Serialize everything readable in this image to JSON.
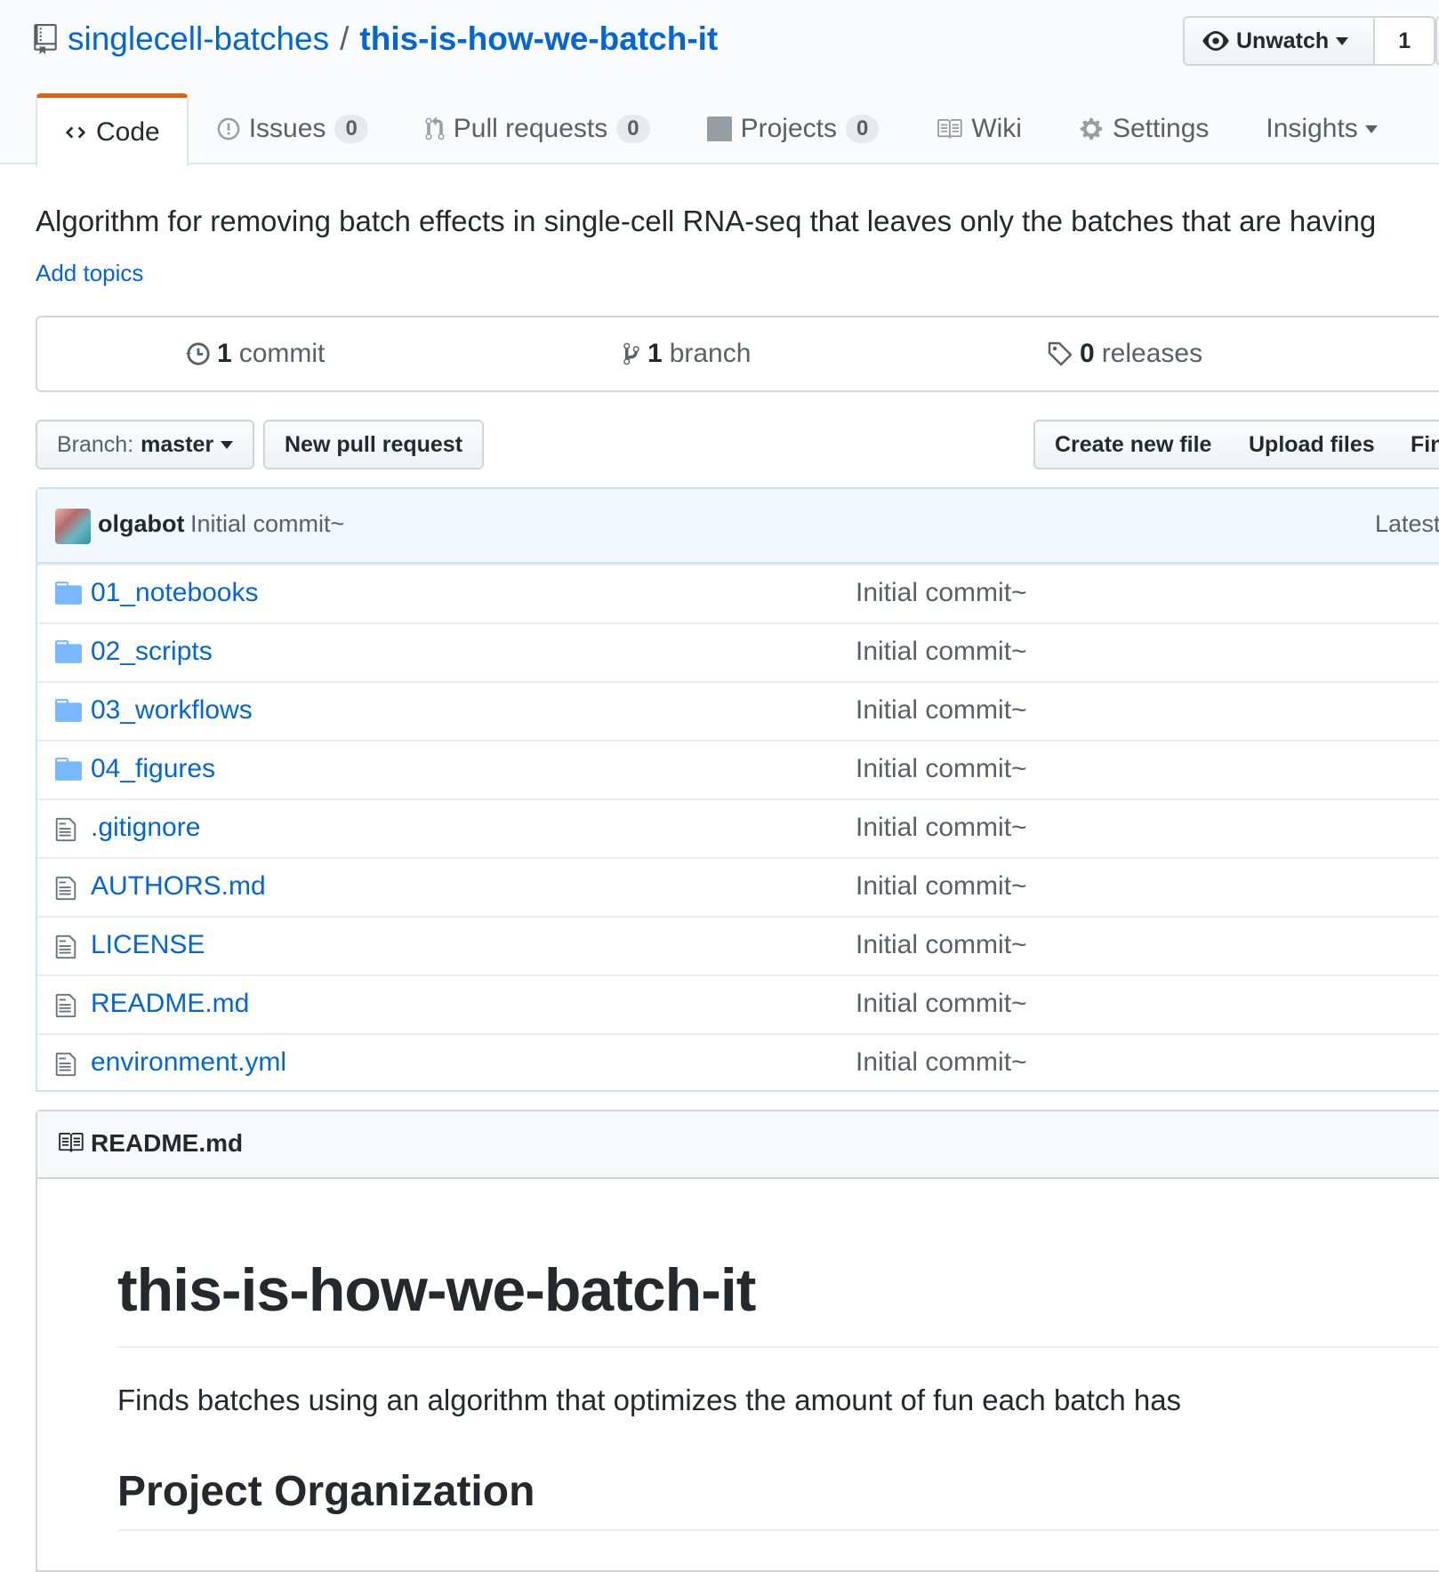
{
  "repo": {
    "owner": "singlecell-batches",
    "separator": "/",
    "name": "this-is-how-we-batch-it"
  },
  "watch": {
    "label": "Unwatch",
    "count": "1"
  },
  "nav": {
    "code": "Code",
    "issues": "Issues",
    "issues_count": "0",
    "pulls": "Pull requests",
    "pulls_count": "0",
    "projects": "Projects",
    "projects_count": "0",
    "wiki": "Wiki",
    "settings": "Settings",
    "insights": "Insights"
  },
  "description": "Algorithm for removing batch effects in single-cell RNA-seq that leaves only the batches that are having",
  "add_topics": "Add topics",
  "summary": {
    "commits_num": "1",
    "commits_label": "commit",
    "branches_num": "1",
    "branches_label": "branch",
    "releases_num": "0",
    "releases_label": "releases"
  },
  "file_nav": {
    "branch_prefix": "Branch:",
    "branch_name": "master",
    "new_pr": "New pull request",
    "create_file": "Create new file",
    "upload_files": "Upload files",
    "find_file": "Fin"
  },
  "commit": {
    "author": "olgabot",
    "message": "Initial commit~",
    "latest": "Latest"
  },
  "files": [
    {
      "name": "01_notebooks",
      "type": "folder",
      "message": "Initial commit~"
    },
    {
      "name": "02_scripts",
      "type": "folder",
      "message": "Initial commit~"
    },
    {
      "name": "03_workflows",
      "type": "folder",
      "message": "Initial commit~"
    },
    {
      "name": "04_figures",
      "type": "folder",
      "message": "Initial commit~"
    },
    {
      "name": ".gitignore",
      "type": "file",
      "message": "Initial commit~"
    },
    {
      "name": "AUTHORS.md",
      "type": "file",
      "message": "Initial commit~"
    },
    {
      "name": "LICENSE",
      "type": "file",
      "message": "Initial commit~"
    },
    {
      "name": "README.md",
      "type": "file",
      "message": "Initial commit~"
    },
    {
      "name": "environment.yml",
      "type": "file",
      "message": "Initial commit~"
    }
  ],
  "readme": {
    "filename": "README.md",
    "title": "this-is-how-we-batch-it",
    "paragraph": "Finds batches using an algorithm that optimizes the amount of fun each batch has",
    "section_heading": "Project Organization"
  },
  "colors": {
    "link": "#0366d6",
    "selected_tab_accent": "#e36209",
    "muted_text": "#586069",
    "commit_tease_bg": "#f1f8ff",
    "folder_icon": "#79b8ff"
  }
}
